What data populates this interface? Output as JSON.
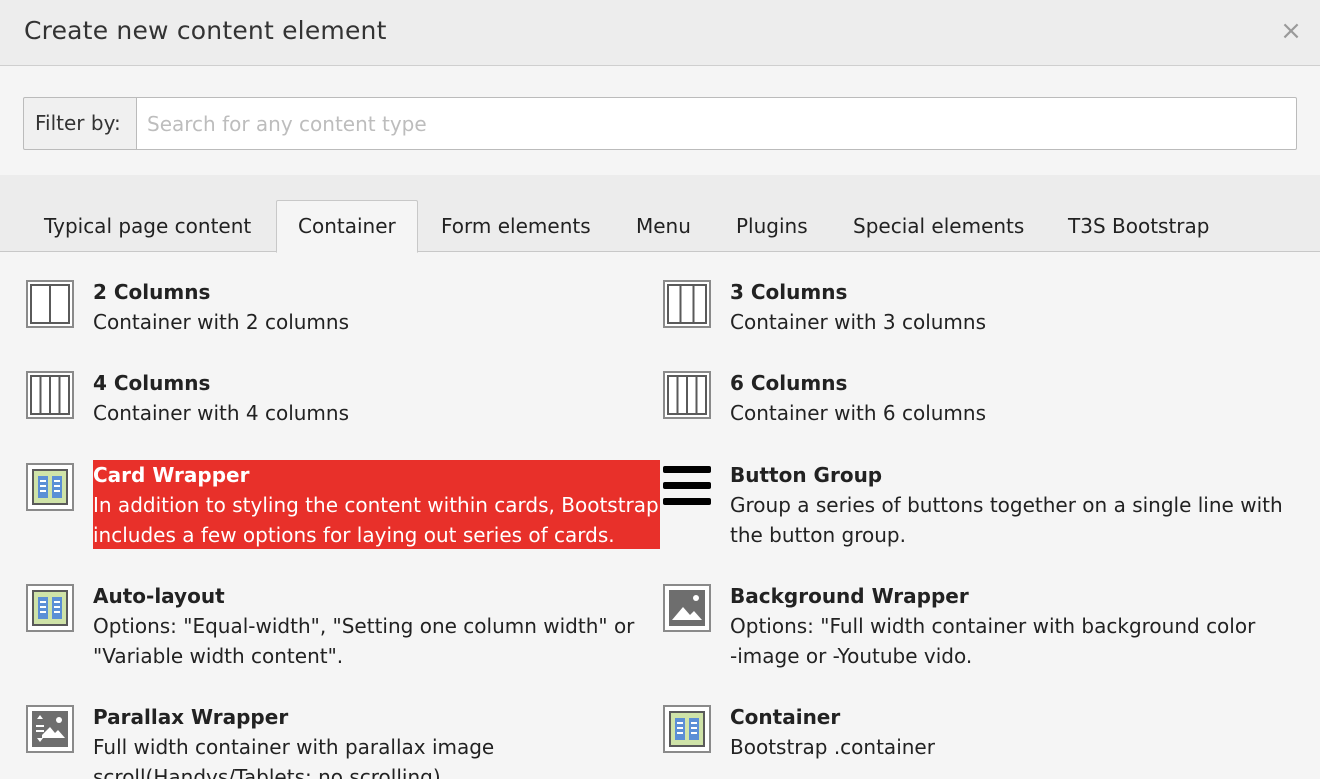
{
  "dialog": {
    "title": "Create new content element",
    "close_icon": "close-icon",
    "close_glyph": "×"
  },
  "filter": {
    "label": "Filter by:",
    "placeholder": "Search for any content type",
    "value": ""
  },
  "tabs": [
    {
      "label": "Typical page content",
      "active": false
    },
    {
      "label": "Container",
      "active": true
    },
    {
      "label": "Form elements",
      "active": false
    },
    {
      "label": "Menu",
      "active": false
    },
    {
      "label": "Plugins",
      "active": false
    },
    {
      "label": "Special elements",
      "active": false
    },
    {
      "label": "T3S Bootstrap",
      "active": false
    }
  ],
  "items": [
    {
      "name": "2 Columns",
      "desc": [
        "Container with 2 columns"
      ],
      "icon": "two-columns-icon"
    },
    {
      "name": "3 Columns",
      "desc": [
        "Container with 3 columns"
      ],
      "icon": "three-columns-icon"
    },
    {
      "name": "4 Columns",
      "desc": [
        "Container with 4 columns"
      ],
      "icon": "four-columns-icon"
    },
    {
      "name": "6 Columns",
      "desc": [
        "Container with 6 columns"
      ],
      "icon": "six-columns-icon"
    },
    {
      "name": "Card Wrapper",
      "desc": [
        "In addition to styling the content within cards, Bootstrap",
        "includes a few options for laying out series of cards."
      ],
      "icon": "card-wrapper-icon",
      "highlighted": true
    },
    {
      "name": "Button Group",
      "desc": [
        "Group a series of buttons together on a single line with",
        "the button group."
      ],
      "icon": "hamburger-menu-icon"
    },
    {
      "name": "Auto-layout",
      "desc": [
        "Options: \"Equal-width\", \"Setting one column width\" or",
        "\"Variable width content\"."
      ],
      "icon": "auto-layout-icon"
    },
    {
      "name": "Background Wrapper",
      "desc": [
        "Options: \"Full width container with background color",
        "-image or -Youtube vido."
      ],
      "icon": "image-icon"
    },
    {
      "name": "Parallax Wrapper",
      "desc": [
        "Full width container with parallax image",
        "scroll(Handys/Tablets: no scrolling)"
      ],
      "icon": "parallax-icon"
    },
    {
      "name": "Container",
      "desc": [
        "Bootstrap .container"
      ],
      "icon": "container-icon"
    }
  ],
  "colors": {
    "highlight": "#e8302a",
    "icon_border": "#8a8a8a",
    "icon_blue": "#5b8fd6",
    "icon_green": "#cfe3a8"
  }
}
